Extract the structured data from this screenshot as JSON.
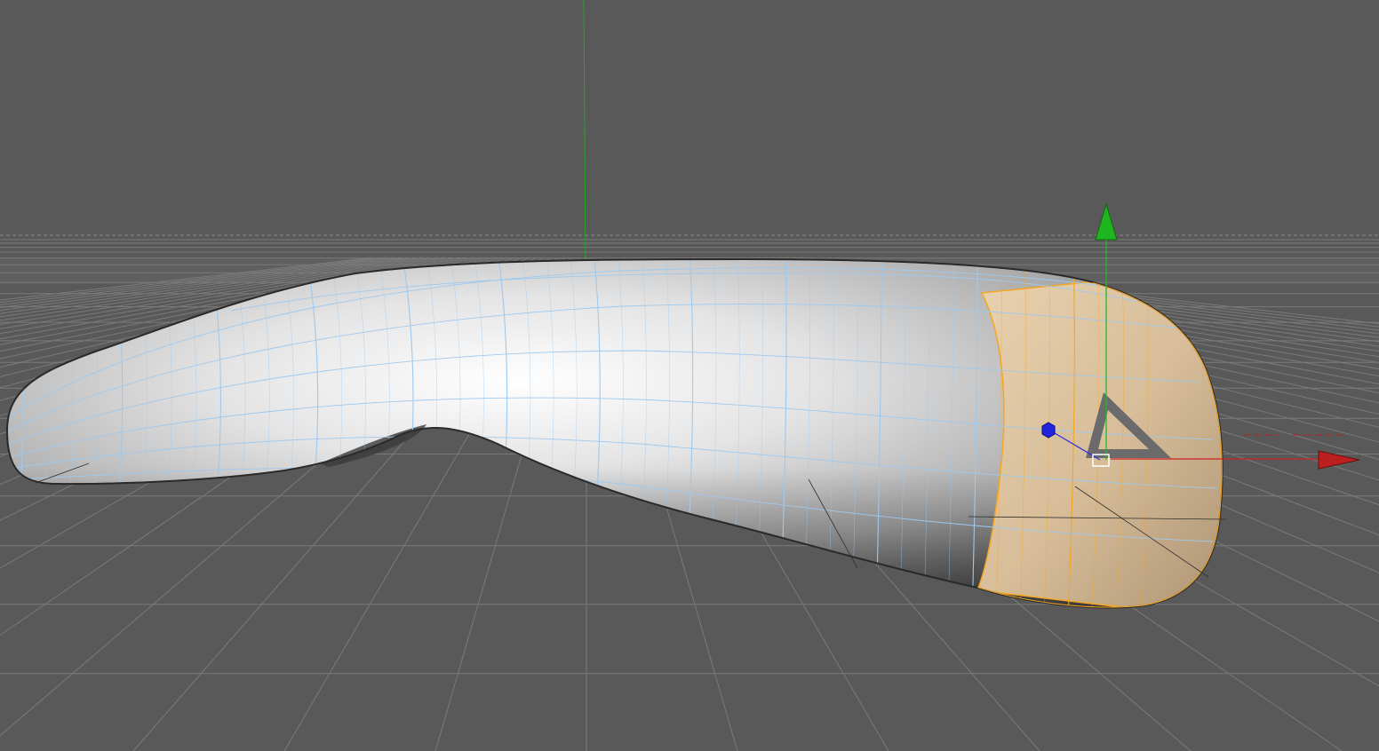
{
  "viewport": {
    "view": "perspective",
    "background_color": "#595959",
    "grid_color": "#7a7a7a",
    "grid": true
  },
  "scene": {
    "object": {
      "shading": "smooth-shaded-with-isoparms",
      "base_color": "#c8c8c8",
      "isoparm_color": "#9ec9ee",
      "selected_faces_color": "#d9c09e",
      "selection_outline_color": "#f5a623"
    },
    "world_axis": {
      "y_axis_color": "#22aa22"
    },
    "manipulator": {
      "x_axis_color": "#cc2222",
      "y_axis_color": "#22bb22",
      "z_axis_color": "#2222dd",
      "pivot_color": "#ffffff",
      "sun_triangle_color": "#6b6b6b"
    }
  }
}
